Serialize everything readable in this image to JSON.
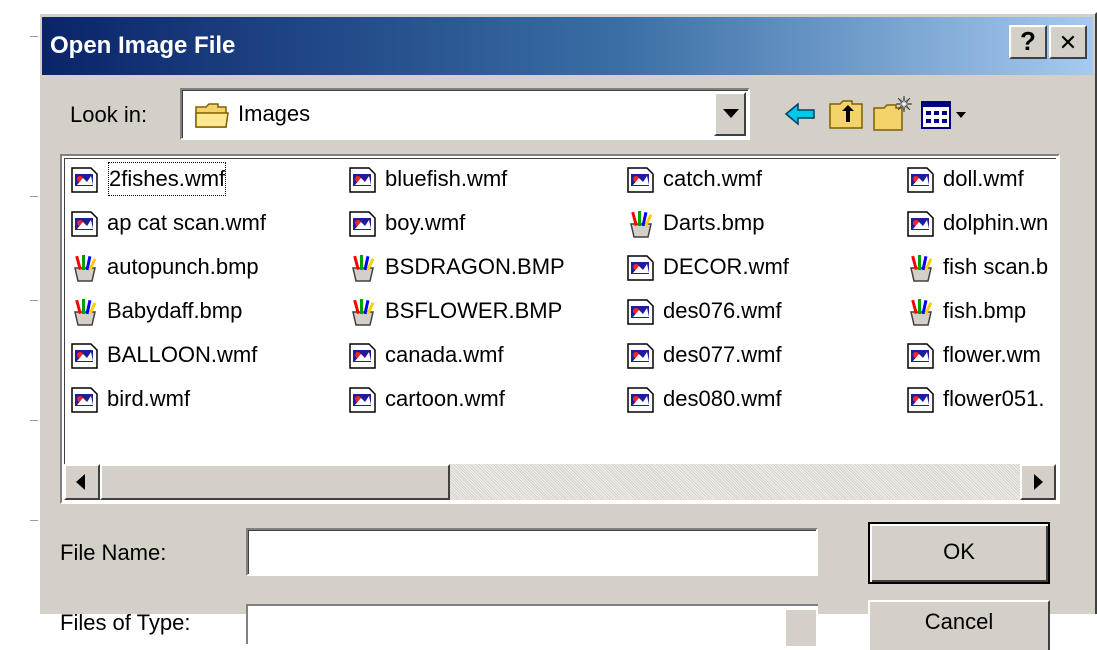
{
  "dialog": {
    "title": "Open Image File",
    "help_label": "?",
    "close_label": "✕"
  },
  "lookin": {
    "label": "Look in:",
    "value": "Images",
    "icon": "folder-icon"
  },
  "toolbar": {
    "icons": [
      "back-arrow-icon",
      "up-folder-icon",
      "new-folder-icon",
      "view-menu-icon"
    ]
  },
  "files": [
    [
      {
        "name": "2fishes.wmf",
        "type": "wmf"
      },
      {
        "name": "ap cat scan.wmf",
        "type": "wmf"
      },
      {
        "name": "autopunch.bmp",
        "type": "bmp"
      },
      {
        "name": "Babydaff.bmp",
        "type": "bmp"
      },
      {
        "name": "BALLOON.wmf",
        "type": "wmf"
      },
      {
        "name": "bird.wmf",
        "type": "wmf"
      }
    ],
    [
      {
        "name": "bluefish.wmf",
        "type": "wmf"
      },
      {
        "name": "boy.wmf",
        "type": "wmf"
      },
      {
        "name": "BSDRAGON.BMP",
        "type": "bmp"
      },
      {
        "name": "BSFLOWER.BMP",
        "type": "bmp"
      },
      {
        "name": "canada.wmf",
        "type": "wmf"
      },
      {
        "name": "cartoon.wmf",
        "type": "wmf"
      }
    ],
    [
      {
        "name": "catch.wmf",
        "type": "wmf"
      },
      {
        "name": "Darts.bmp",
        "type": "bmp"
      },
      {
        "name": "DECOR.wmf",
        "type": "wmf"
      },
      {
        "name": "des076.wmf",
        "type": "wmf"
      },
      {
        "name": "des077.wmf",
        "type": "wmf"
      },
      {
        "name": "des080.wmf",
        "type": "wmf"
      }
    ],
    [
      {
        "name": "doll.wmf",
        "type": "wmf"
      },
      {
        "name": "dolphin.wn",
        "type": "wmf"
      },
      {
        "name": "fish scan.b",
        "type": "bmp"
      },
      {
        "name": "fish.bmp",
        "type": "bmp"
      },
      {
        "name": "flower.wm",
        "type": "wmf"
      },
      {
        "name": "flower051.",
        "type": "wmf"
      }
    ]
  ],
  "filename": {
    "label": "File Name:",
    "value": "",
    "placeholder": ""
  },
  "filetype": {
    "label": "Files of Type:"
  },
  "buttons": {
    "ok": "OK",
    "cancel": "Cancel"
  },
  "colors": {
    "titlebar_start": "#0a246a",
    "titlebar_end": "#a6caf0",
    "face": "#d4d0c8"
  }
}
